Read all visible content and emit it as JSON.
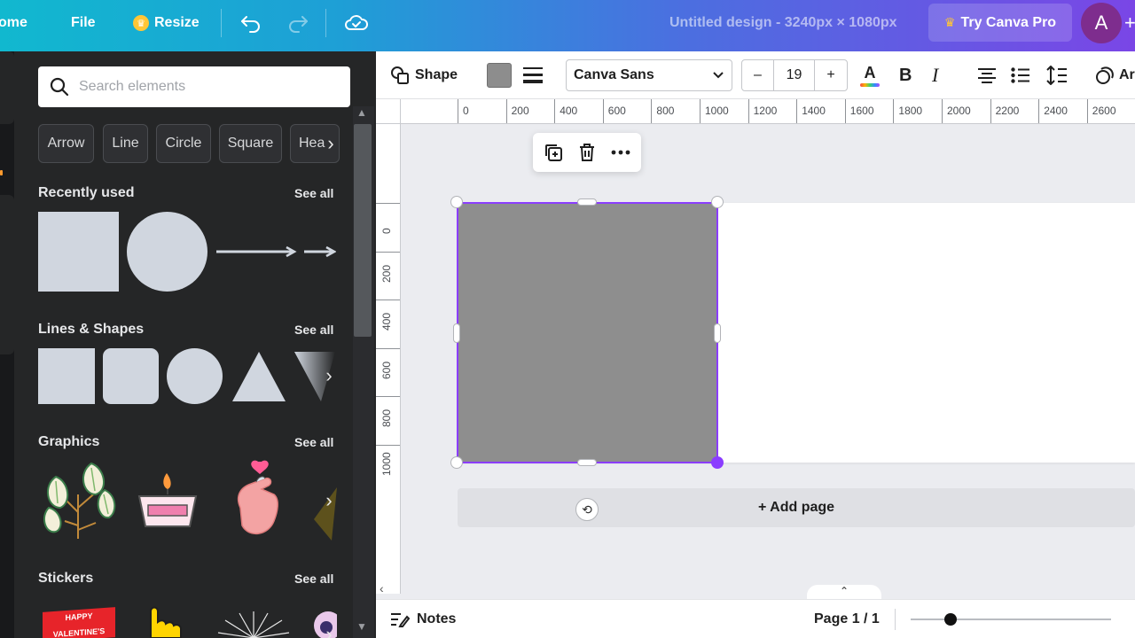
{
  "topbar": {
    "home_label": "ome",
    "file_label": "File",
    "resize_label": "Resize",
    "design_title": "Untitled design - 3240px × 1080px",
    "try_pro_label": "Try Canva Pro",
    "avatar_initial": "A",
    "plus_symbol": "+",
    "crown_icon": "♛"
  },
  "panel": {
    "search_placeholder": "Search elements",
    "chips": [
      "Arrow",
      "Line",
      "Circle",
      "Square",
      "Hea"
    ],
    "see_all": "See all",
    "sections": {
      "recently_used": "Recently used",
      "lines_shapes": "Lines & Shapes",
      "graphics": "Graphics",
      "stickers": "Stickers"
    },
    "sticker_text_1": "HAPPY",
    "sticker_text_2": "VALENTINE'S"
  },
  "toolbar": {
    "shape_label": "Shape",
    "font_name": "Canva Sans",
    "font_size": "19",
    "minus": "–",
    "plus": "+",
    "text_color_glyph": "A",
    "bold_glyph": "B",
    "italic_glyph": "I",
    "effects_label_partial": "Ar",
    "fill_color": "#8d8d8d"
  },
  "rulers": {
    "horizontal": [
      "0",
      "200",
      "400",
      "600",
      "800",
      "1000",
      "1200",
      "1400",
      "1600",
      "1800",
      "2000",
      "2200",
      "2400",
      "2600"
    ],
    "vertical": [
      "0",
      "200",
      "400",
      "600",
      "800",
      "1000"
    ]
  },
  "canvas": {
    "add_page_label": "+ Add page",
    "accent_color": "#8b3dff",
    "shape_color": "#8e8e8e"
  },
  "bottombar": {
    "notes_label": "Notes",
    "page_indicator": "Page 1 / 1",
    "zoom_level": 0.2
  }
}
